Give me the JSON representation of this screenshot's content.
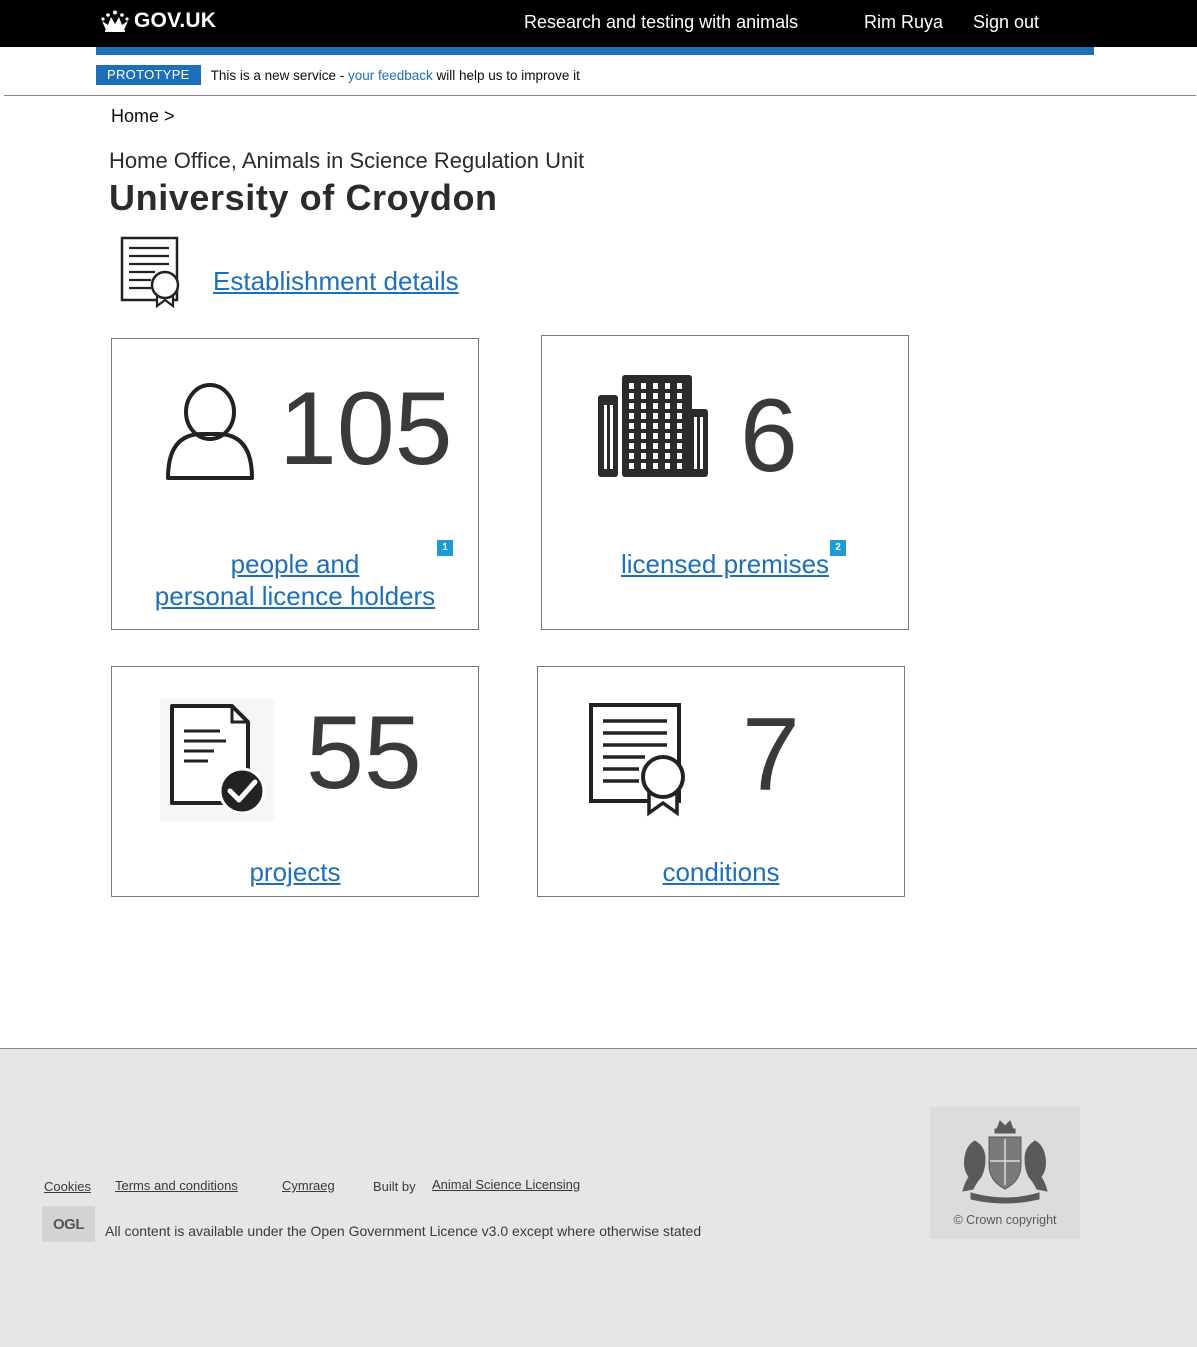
{
  "header": {
    "logo_text": "GOV.UK",
    "service_name": "Research and testing with animals",
    "user_name": "Rim Ruya",
    "signout_label": "Sign out"
  },
  "phase_banner": {
    "tag": "PROTOTYPE",
    "text_before": "This is a new service - ",
    "feedback_link": "your feedback",
    "text_after": " will help us to improve it"
  },
  "breadcrumb": {
    "home": "Home >"
  },
  "page": {
    "caption": "Home Office, Animals in Science Regulation Unit",
    "title": "University of Croydon",
    "establishment_link": "Establishment details"
  },
  "cards": {
    "people": {
      "count": "105",
      "label_line1": "people and",
      "label_line2": "personal licence holders",
      "badge": "1",
      "icon": "person-icon"
    },
    "premises": {
      "count": "6",
      "label": "licensed premises",
      "badge": "2",
      "icon": "building-icon"
    },
    "projects": {
      "count": "55",
      "label": "projects",
      "icon": "document-check-icon"
    },
    "conditions": {
      "count": "7",
      "label": "conditions",
      "icon": "certificate-icon"
    }
  },
  "footer": {
    "links": {
      "cookies": "Cookies",
      "terms": "Terms and conditions",
      "cymraeg": "Cymraeg",
      "built_by_label": "Built by",
      "built_by_link": "Animal Science Licensing"
    },
    "ogl_logo": "OGL",
    "licence_before": "All content is available under the ",
    "licence_link": "Open Government Licence v3.0",
    "licence_after": " except where otherwise stated",
    "copyright": "© Crown copyright"
  },
  "colors": {
    "header_bg": "#000000",
    "accent_blue": "#1d70b8",
    "badge_blue": "#1d9bd6",
    "footer_bg": "#e6e6e6"
  }
}
